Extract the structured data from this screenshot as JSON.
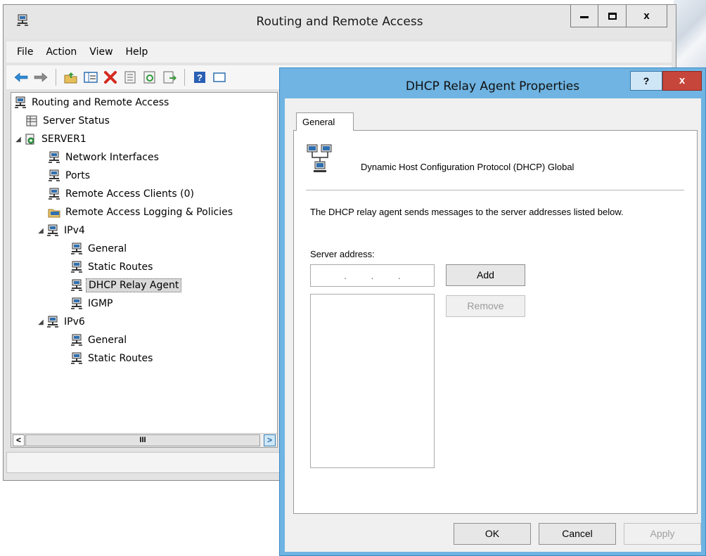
{
  "main_window": {
    "title": "Routing and Remote Access",
    "caption_buttons": {
      "minimize_icon": "minimize-icon",
      "maximize_icon": "maximize-icon",
      "close": "x"
    }
  },
  "menu": [
    "File",
    "Action",
    "View",
    "Help"
  ],
  "toolbar_icons": [
    "back-arrow-icon",
    "forward-arrow-icon",
    "up-folder-icon",
    "show-hide-tree-icon",
    "delete-icon",
    "properties-icon",
    "refresh-icon",
    "export-list-icon",
    "help-icon",
    "console-icon"
  ],
  "tree": {
    "root": "Routing and Remote Access",
    "server_status": "Server Status",
    "server": "SERVER1",
    "network_interfaces": "Network Interfaces",
    "ports": "Ports",
    "remote_access_clients": "Remote Access Clients (0)",
    "remote_access_logging": "Remote Access Logging & Policies",
    "ipv4": "IPv4",
    "ipv4_general": "General",
    "ipv4_static_routes": "Static Routes",
    "ipv4_dhcp_relay": "DHCP Relay Agent",
    "ipv4_igmp": "IGMP",
    "ipv6": "IPv6",
    "ipv6_general": "General",
    "ipv6_static_routes": "Static Routes"
  },
  "scrollbar": {
    "left": "<",
    "thumb": "III",
    "right": ">"
  },
  "dialog": {
    "title": "DHCP Relay Agent Properties",
    "help_button": "?",
    "close_button": "x",
    "tab": "General",
    "protocol_label": "Dynamic Host Configuration Protocol (DHCP) Global",
    "description": "The DHCP relay agent sends messages to the server addresses listed below.",
    "server_address_label": "Server address:",
    "ip_separators": [
      ".",
      ".",
      "."
    ],
    "add_button": "Add",
    "remove_button": "Remove",
    "ok_button": "OK",
    "cancel_button": "Cancel",
    "apply_button": "Apply"
  },
  "colors": {
    "dialog_frame": "#6fb4e2",
    "close_red": "#c7463b",
    "selection": "#d9d9d9"
  }
}
